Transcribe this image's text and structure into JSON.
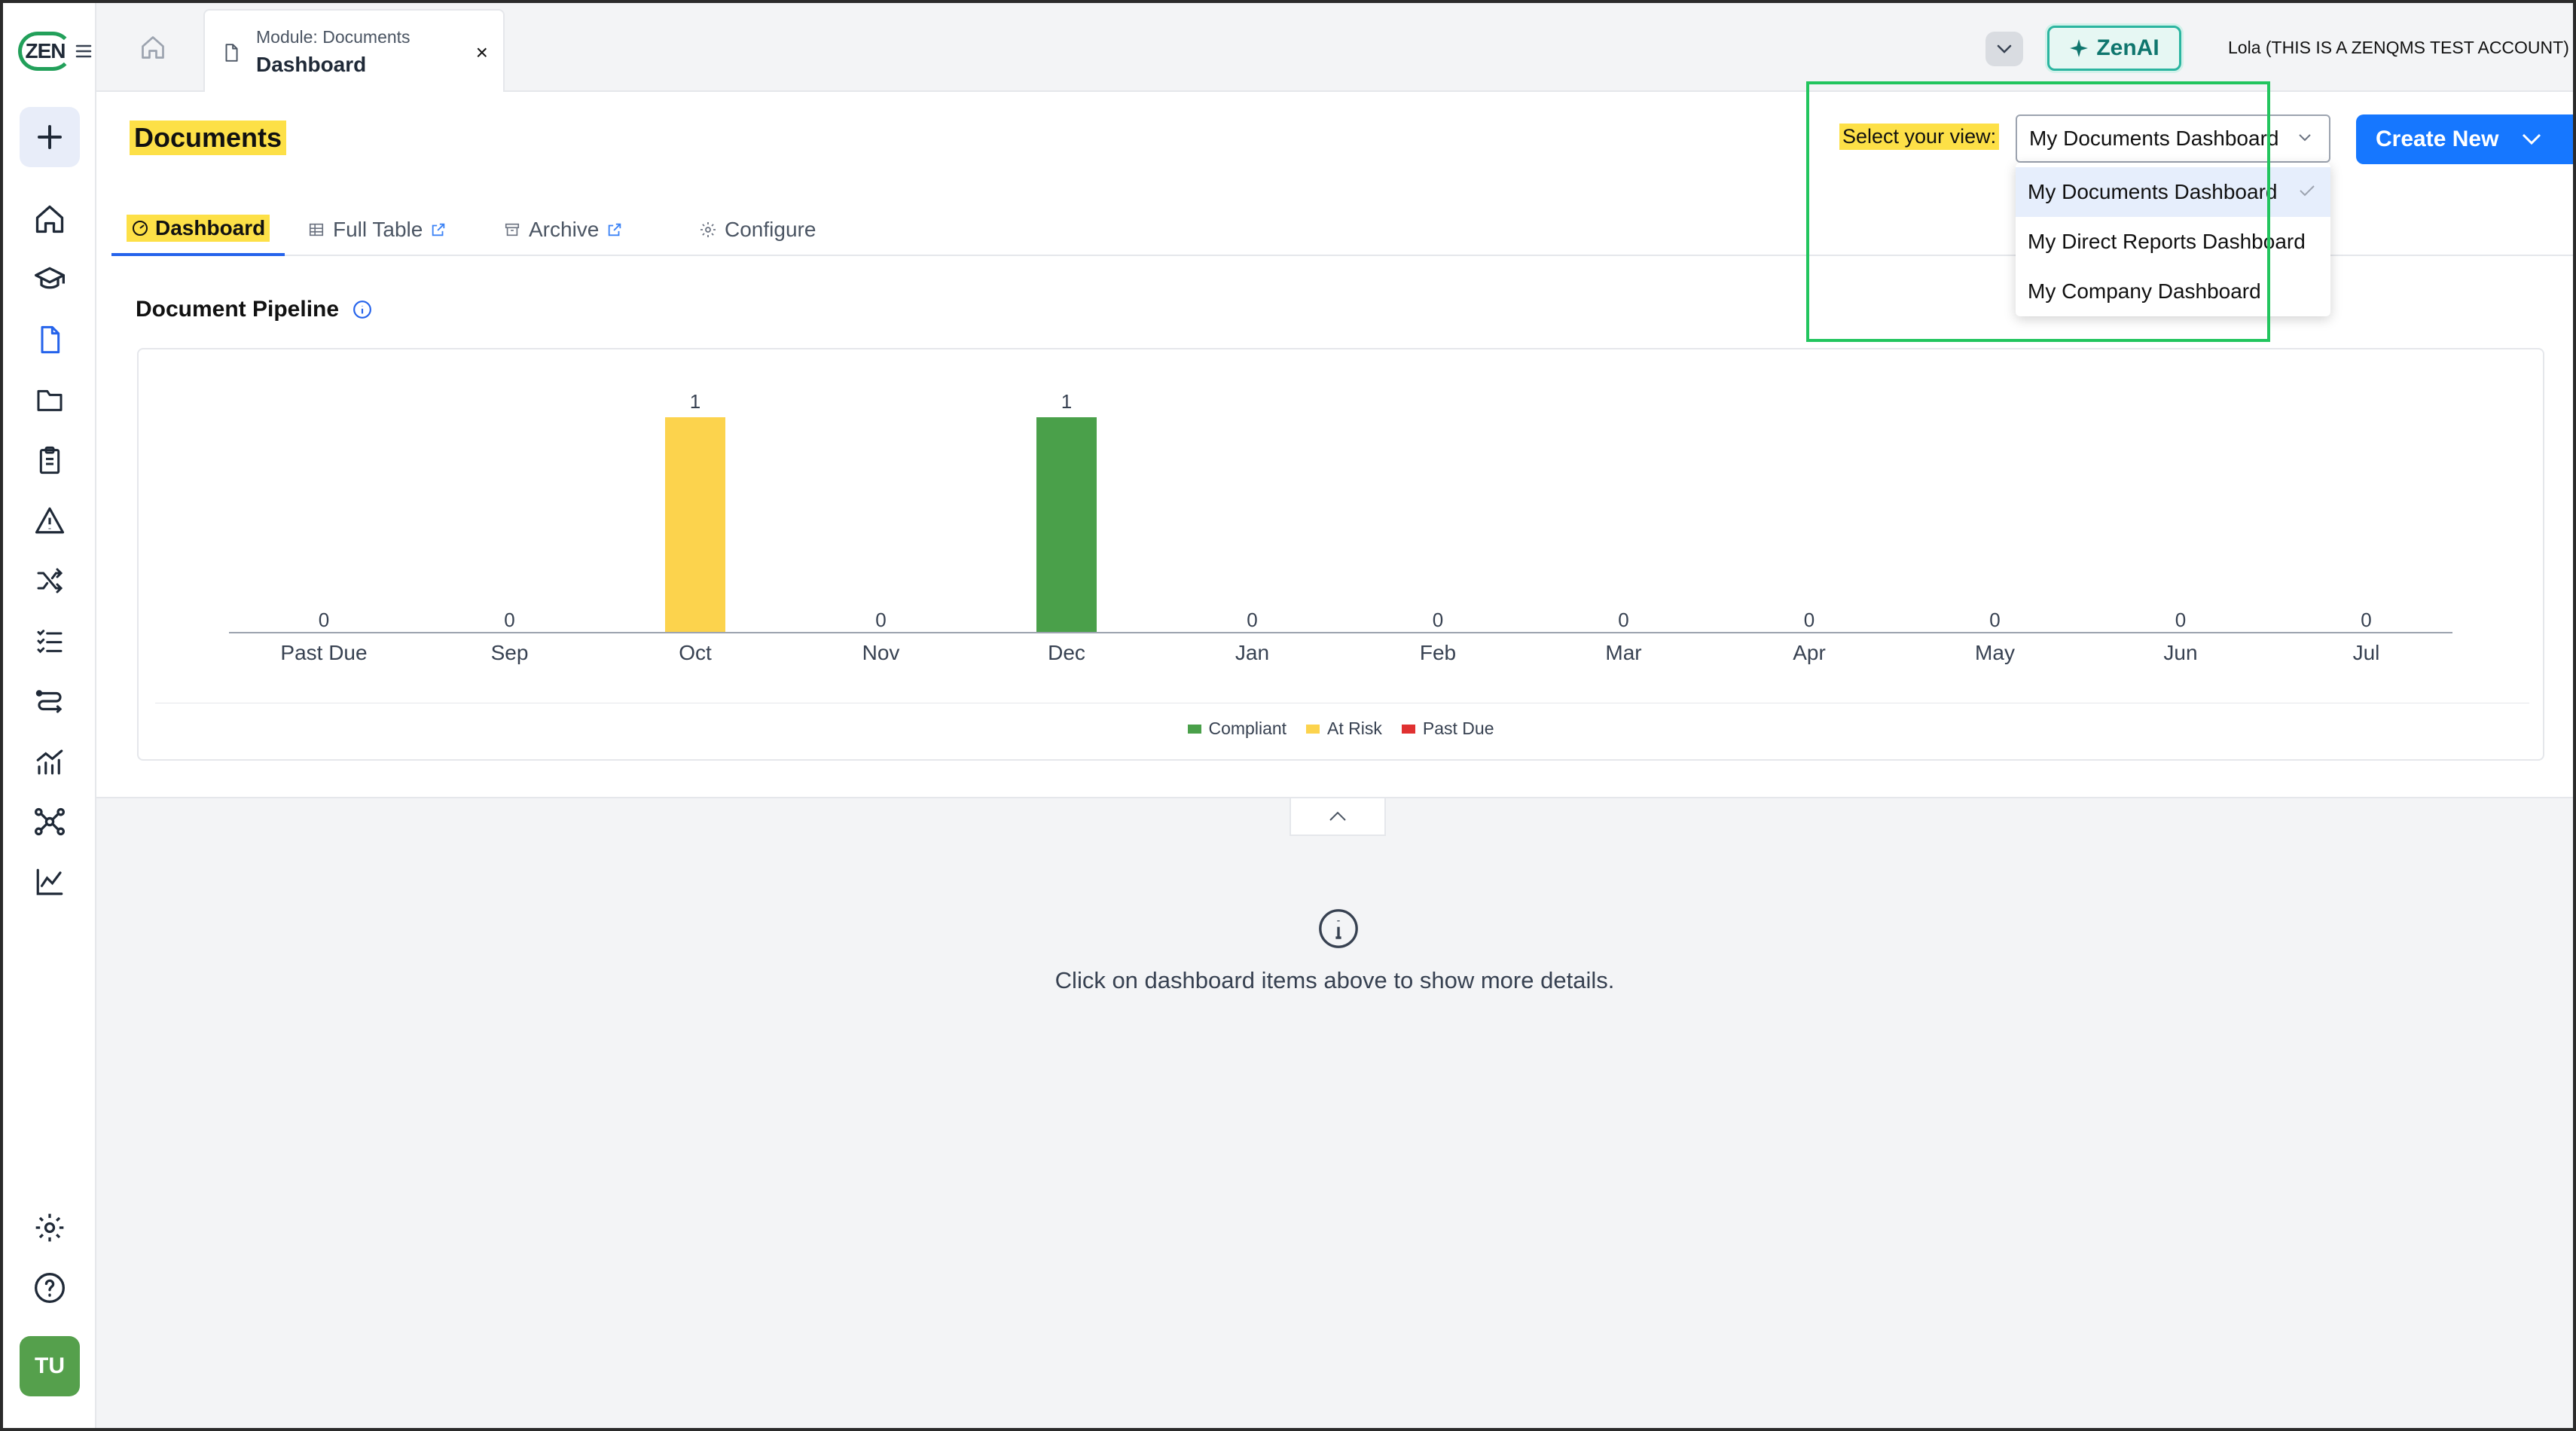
{
  "app": {
    "logo_text": "ZEN",
    "account_name": "Lola (THIS IS A ZENQMS TEST ACCOUNT)",
    "zenai_label": "ZenAI",
    "user_initials": "TU"
  },
  "tab": {
    "module_label": "Module: Documents",
    "title": "Dashboard",
    "close": "×"
  },
  "sidebar": {
    "items": [
      {
        "icon": "home-icon"
      },
      {
        "icon": "graduation-cap-icon"
      },
      {
        "icon": "document-icon"
      },
      {
        "icon": "folder-icon"
      },
      {
        "icon": "clipboard-icon"
      },
      {
        "icon": "warning-icon"
      },
      {
        "icon": "shuffle-icon"
      },
      {
        "icon": "checklist-icon"
      },
      {
        "icon": "workflow-icon"
      },
      {
        "icon": "analytics-icon"
      },
      {
        "icon": "network-icon"
      },
      {
        "icon": "line-chart-icon"
      }
    ],
    "bottom": [
      {
        "icon": "gear-icon"
      },
      {
        "icon": "help-icon"
      }
    ]
  },
  "page": {
    "title": "Documents",
    "tabs": [
      {
        "label": "Dashboard",
        "icon": "dashboard-icon"
      },
      {
        "label": "Full Table",
        "icon": "table-icon"
      },
      {
        "label": "Archive",
        "icon": "archive-icon"
      },
      {
        "label": "Configure",
        "icon": "gear-icon"
      }
    ],
    "view_label": "Select your view:",
    "view_selected": "My Documents Dashboard",
    "view_options": [
      "My Documents Dashboard",
      "My Direct Reports Dashboard",
      "My Company Dashboard"
    ],
    "create_new": "Create New",
    "section_title": "Document Pipeline",
    "hint": "Click on dashboard items above to show more details."
  },
  "colors": {
    "compliant": "#4aa04a",
    "at_risk": "#fcd34d",
    "past_due": "#e03131",
    "accent": "#1677ff"
  },
  "chart_data": {
    "type": "bar",
    "title": "Document Pipeline",
    "categories": [
      "Past Due",
      "Sep",
      "Oct",
      "Nov",
      "Dec",
      "Jan",
      "Feb",
      "Mar",
      "Apr",
      "May",
      "Jun",
      "Jul"
    ],
    "series": [
      {
        "name": "Compliant",
        "values": [
          0,
          0,
          0,
          0,
          1,
          0,
          0,
          0,
          0,
          0,
          0,
          0
        ]
      },
      {
        "name": "At Risk",
        "values": [
          0,
          0,
          1,
          0,
          0,
          0,
          0,
          0,
          0,
          0,
          0,
          0
        ]
      },
      {
        "name": "Past Due",
        "values": [
          0,
          0,
          0,
          0,
          0,
          0,
          0,
          0,
          0,
          0,
          0,
          0
        ]
      }
    ],
    "totals": [
      0,
      0,
      1,
      0,
      1,
      0,
      0,
      0,
      0,
      0,
      0,
      0
    ],
    "ylim": [
      0,
      1
    ],
    "legend_position": "bottom",
    "grid": false
  }
}
